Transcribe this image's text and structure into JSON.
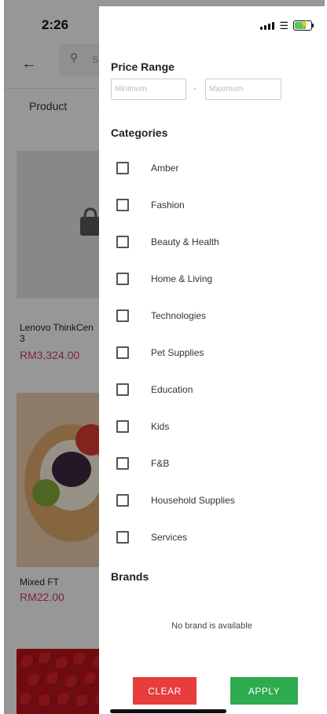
{
  "status_bar": {
    "time": "2:26"
  },
  "background": {
    "search_placeholder": "Se",
    "filter_label": "Product",
    "products": [
      {
        "name_line1": "Lenovo ThinkCen",
        "name_line2": "3",
        "price": "RM3,324.00"
      },
      {
        "name_line1": "Mixed FT",
        "name_line2": "",
        "price": "RM22.00"
      }
    ]
  },
  "filter_panel": {
    "price_range": {
      "title": "Price Range",
      "min_placeholder": "Minimum",
      "max_placeholder": "Maximum",
      "separator": "-"
    },
    "categories_title": "Categories",
    "categories": [
      "Amber",
      "Fashion",
      "Beauty & Health",
      "Home & Living",
      "Technologies",
      "Pet Supplies",
      "Education",
      "Kids",
      "F&B",
      "Household Supplies",
      "Services"
    ],
    "brands_title": "Brands",
    "brands_empty": "No brand is available",
    "clear_label": "CLEAR",
    "apply_label": "APPLY"
  },
  "colors": {
    "clear_button": "#e63d3d",
    "apply_button": "#2eaa4f",
    "price_text": "#c83a73"
  }
}
